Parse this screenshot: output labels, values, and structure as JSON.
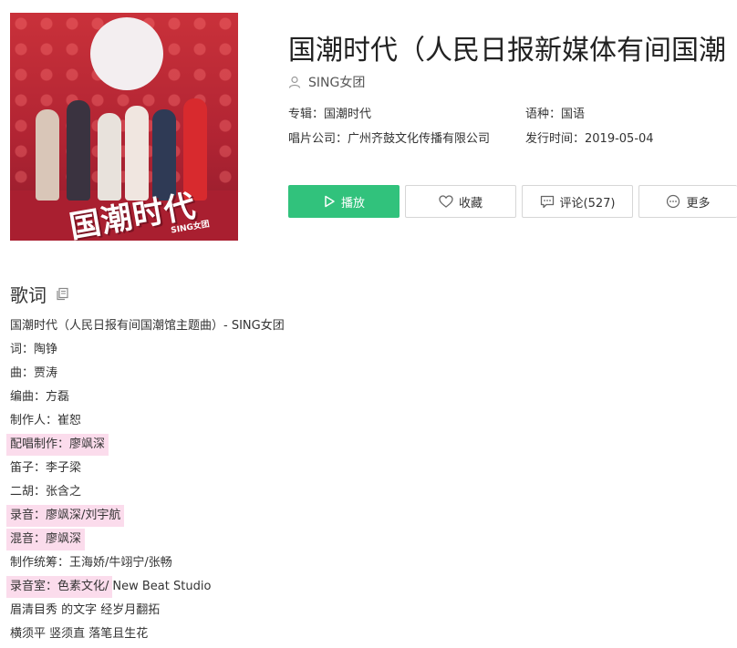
{
  "song": {
    "title": "国潮时代（人民日报新媒体有间国潮",
    "artist": "SING女团",
    "cover_art_text": "国潮时代",
    "cover_art_subtext": "SING女团"
  },
  "meta": {
    "album": "专辑：国潮时代",
    "language": "语种：国语",
    "label": "唱片公司：广州齐鼓文化传播有限公司",
    "release": "发行时间：2019-05-04"
  },
  "actions": {
    "play": "播放",
    "favorite": "收藏",
    "comment": "评论(527)",
    "more": "更多"
  },
  "lyrics": {
    "heading": "歌词",
    "lines": [
      "国潮时代（人民日报有间国潮馆主题曲）- SING女团",
      "词：陶铮",
      "曲：贾涛",
      "编曲：方磊",
      "制作人：崔恕",
      "配唱制作：廖飒深",
      "笛子：李子梁",
      "二胡：张含之",
      "录音：廖飒深/刘宇航",
      "混音：廖飒深",
      "制作统筹：王海娇/牛翊宁/张畅",
      "录音室：色素文化/",
      "New Beat Studio",
      "眉清目秀 的文字 经岁月翻拓",
      "横须平 竖须直 落笔且生花"
    ]
  },
  "colors": {
    "accent": "#31c27c",
    "highlight": "#fbdcec"
  },
  "icons": {
    "artist": "user-icon",
    "play": "play-icon",
    "favorite": "heart-icon",
    "comment": "comment-icon",
    "more": "more-icon",
    "copy": "copy-icon"
  }
}
